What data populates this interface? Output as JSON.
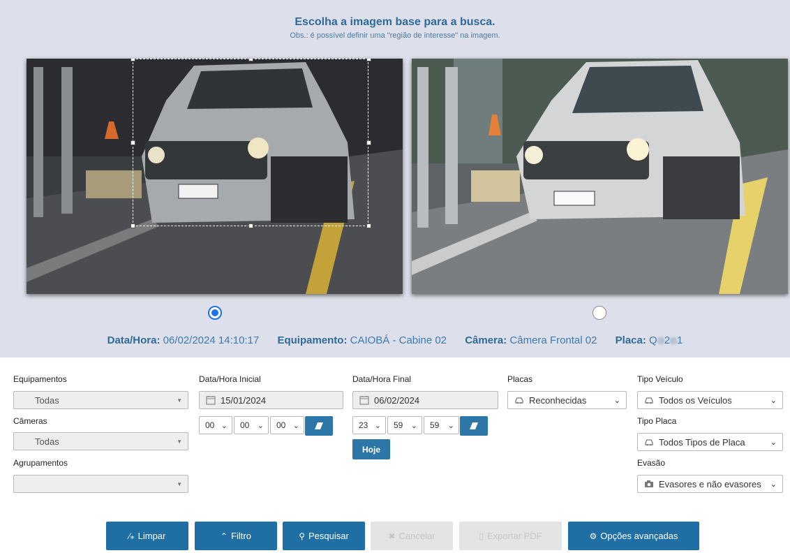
{
  "header": {
    "title": "Escolha a imagem base para a busca.",
    "subtitle": "Obs.: é possível definir uma \"região de interesse\" na imagem."
  },
  "images": [
    {
      "selected": true
    },
    {
      "selected": false
    }
  ],
  "info": {
    "datahora_label": "Data/Hora:",
    "datahora_value": "06/02/2024 14:10:17",
    "equip_label": "Equipamento:",
    "equip_value": "CAIOBÁ - Cabine 02",
    "camera_label": "Câmera:",
    "camera_value": "Câmera Frontal 02",
    "placa_label": "Placa:",
    "placa_p1": "Q",
    "placa_p2": "2",
    "placa_p3": "1"
  },
  "filters": {
    "equipamentos_label": "Equipamentos",
    "equipamentos_value": "Todas",
    "cameras_label": "Câmeras",
    "cameras_value": "Todas",
    "agrupamentos_label": "Agrupamentos",
    "agrupamentos_value": "",
    "inicial_label": "Data/Hora Inicial",
    "inicial_date": "15/01/2024",
    "inicial_h": "00",
    "inicial_m": "00",
    "inicial_s": "00",
    "final_label": "Data/Hora Final",
    "final_date": "06/02/2024",
    "final_h": "23",
    "final_m": "59",
    "final_s": "59",
    "hoje_label": "Hoje",
    "placas_label": "Placas",
    "placas_value": "Reconhecidas",
    "tipo_veiculo_label": "Tipo Veículo",
    "tipo_veiculo_value": "Todos os Veículos",
    "tipo_placa_label": "Tipo Placa",
    "tipo_placa_value": "Todos Tipos de Placa",
    "evasao_label": "Evasão",
    "evasao_value": "Evasores e não evasores"
  },
  "buttons": {
    "limpar": "Limpar",
    "filtro": "Filtro",
    "pesquisar": "Pesquisar",
    "cancelar": "Cancelar",
    "exportar": "Exportar PDF",
    "opcoes": "Opções avançadas"
  },
  "colors": {
    "primary": "#1f6fa4",
    "header_bg": "#dde0ea",
    "label_blue": "#2e6a9a",
    "radio_accent": "#1a73e8"
  }
}
